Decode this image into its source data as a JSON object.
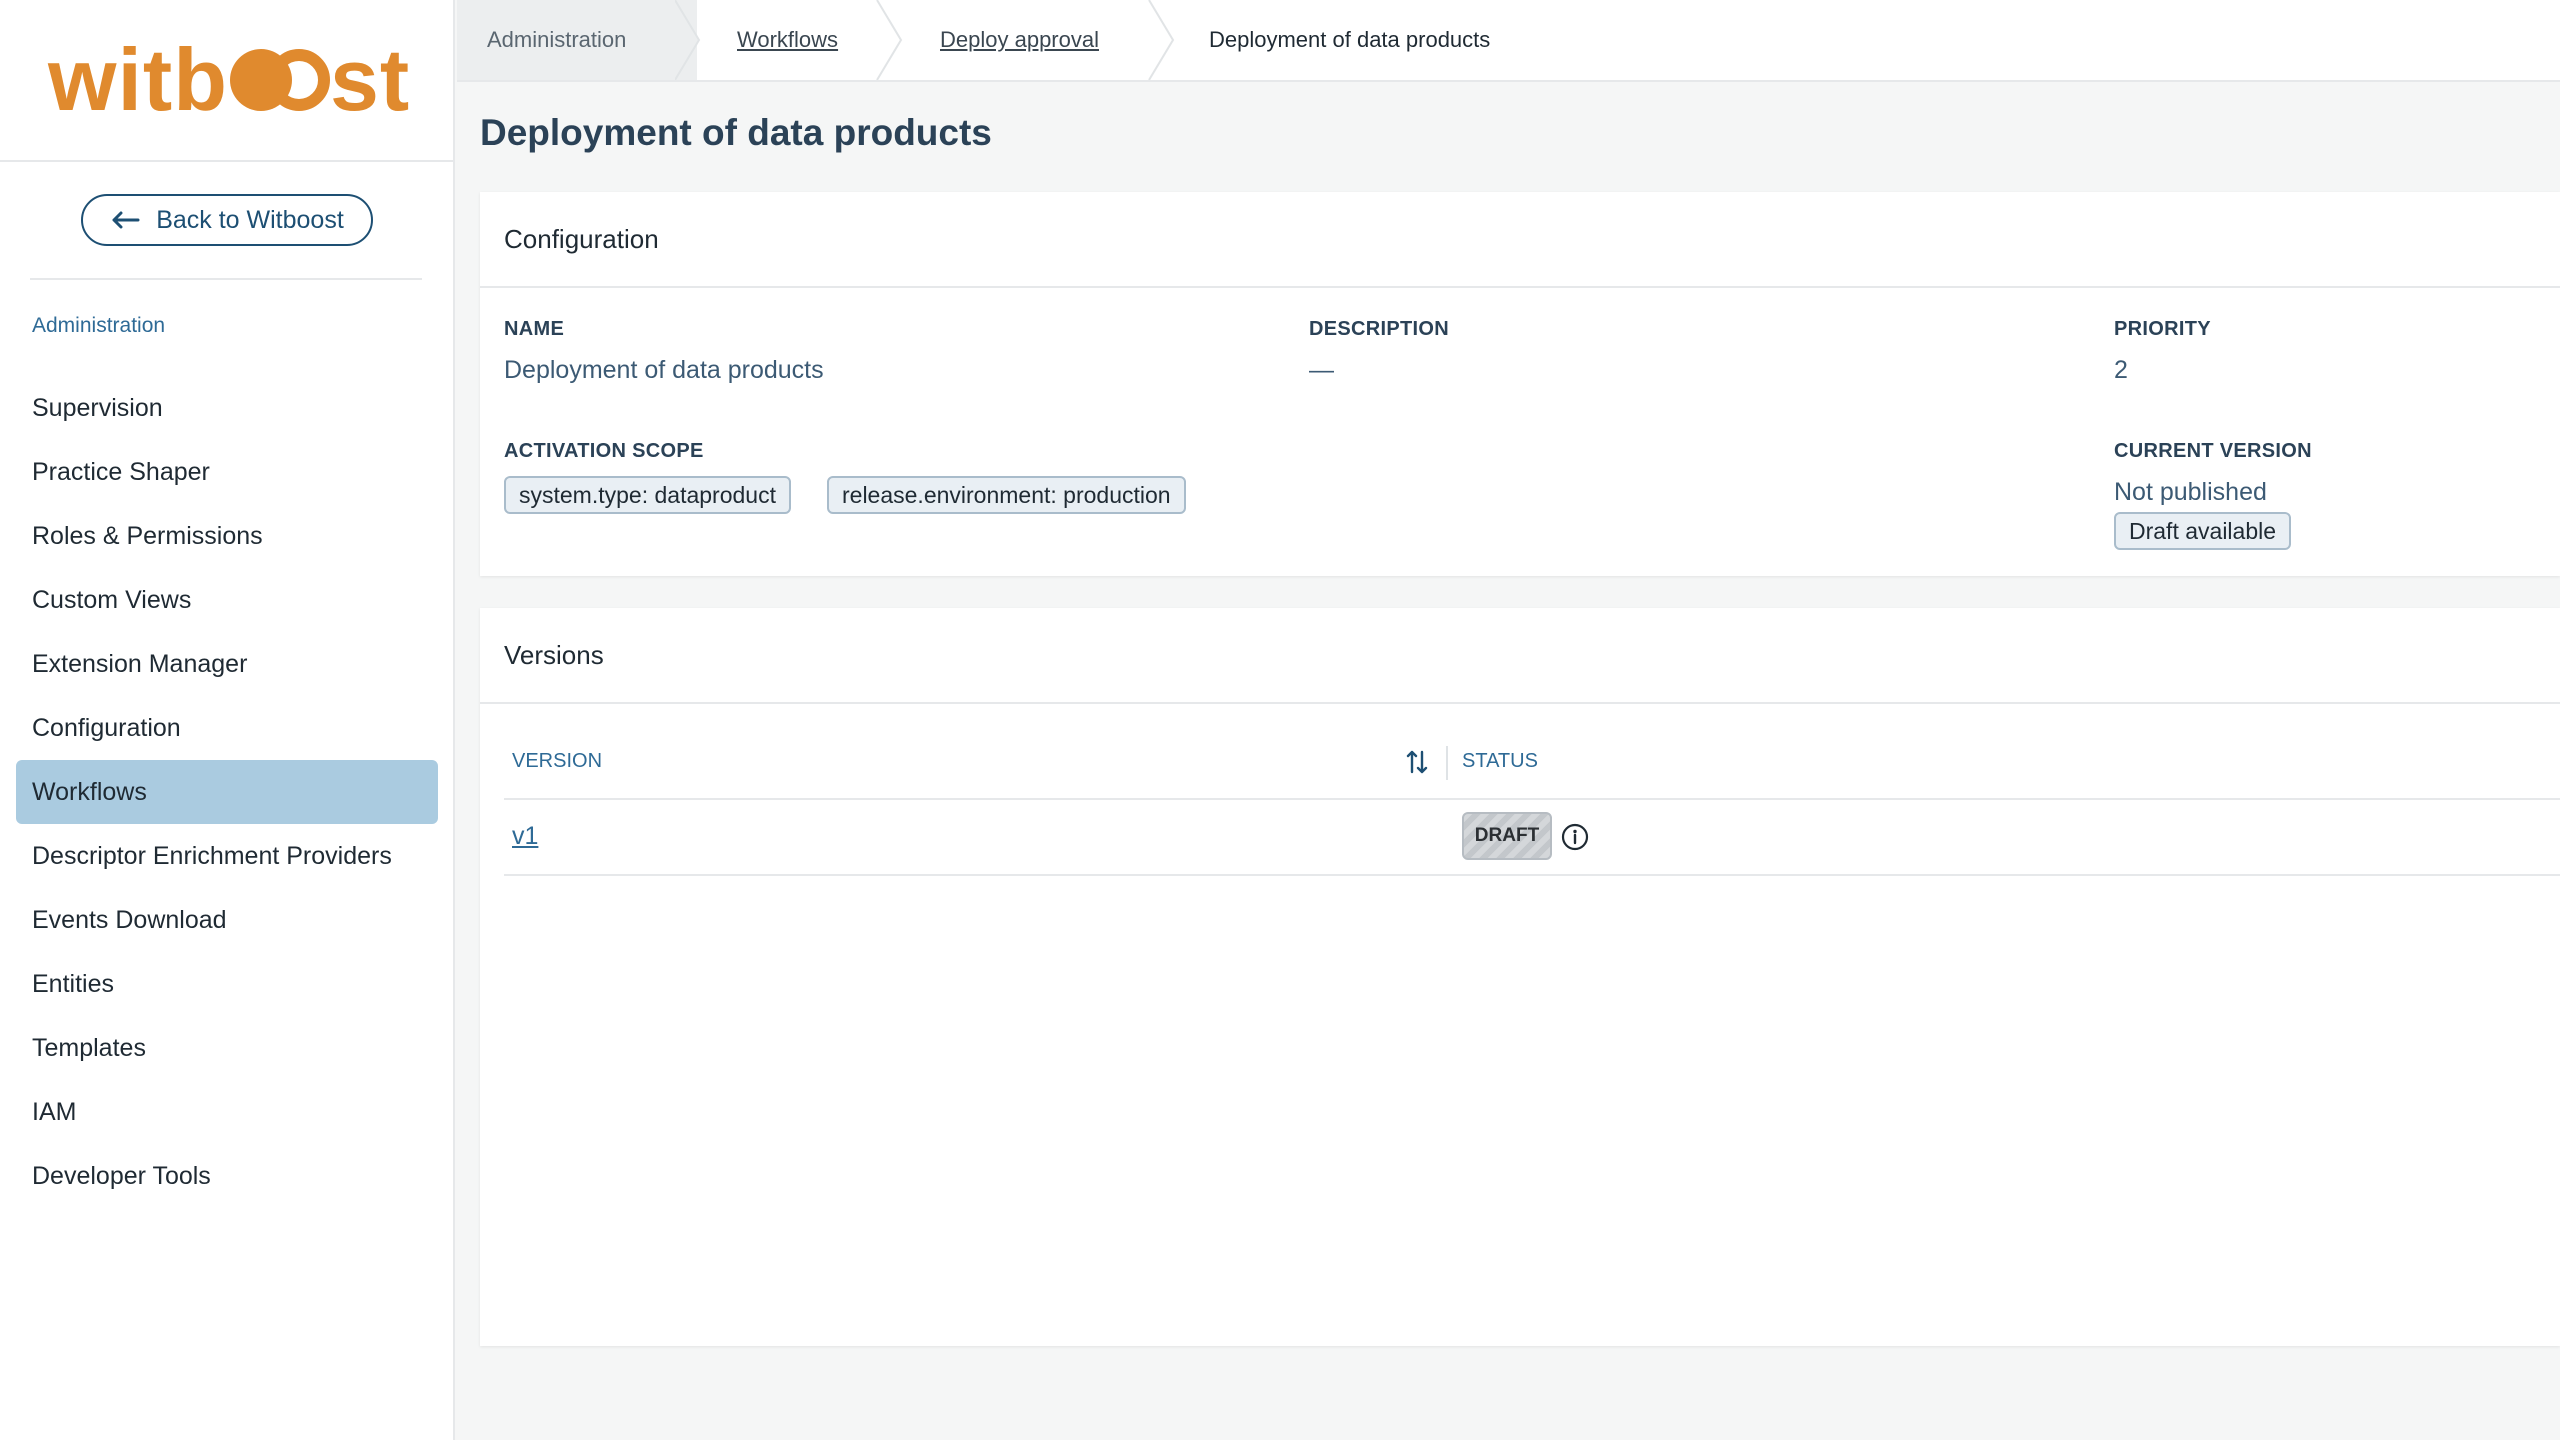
{
  "brand": {
    "logo_left": "witb",
    "logo_right": "st",
    "accent": "#e08a2e"
  },
  "sidebar": {
    "back_label": "Back to Witboost",
    "section_title": "Administration",
    "items": [
      {
        "label": "Supervision"
      },
      {
        "label": "Practice Shaper"
      },
      {
        "label": "Roles & Permissions"
      },
      {
        "label": "Custom Views"
      },
      {
        "label": "Extension Manager"
      },
      {
        "label": "Configuration"
      },
      {
        "label": "Workflows",
        "active": true
      },
      {
        "label": "Descriptor Enrichment Providers"
      },
      {
        "label": "Events Download"
      },
      {
        "label": "Entities"
      },
      {
        "label": "Templates"
      },
      {
        "label": "IAM"
      },
      {
        "label": "Developer Tools"
      }
    ]
  },
  "breadcrumb": {
    "home": "Administration",
    "items": [
      "Workflows",
      "Deploy approval"
    ],
    "current": "Deployment of data products"
  },
  "page": {
    "title": "Deployment of data products"
  },
  "configuration": {
    "header": "Configuration",
    "name_label": "NAME",
    "name_value": "Deployment of data products",
    "description_label": "DESCRIPTION",
    "description_value": "—",
    "priority_label": "PRIORITY",
    "priority_value": "2",
    "activation_scope_label": "ACTIVATION SCOPE",
    "activation_scope_chips": [
      "system.type: dataproduct",
      "release.environment: production"
    ],
    "current_version_label": "CURRENT VERSION",
    "current_version_value": "Not published",
    "current_version_chip": "Draft available"
  },
  "versions": {
    "header": "Versions",
    "columns": [
      "VERSION",
      "STATUS"
    ],
    "rows": [
      {
        "version": "v1",
        "status": "DRAFT"
      }
    ]
  }
}
